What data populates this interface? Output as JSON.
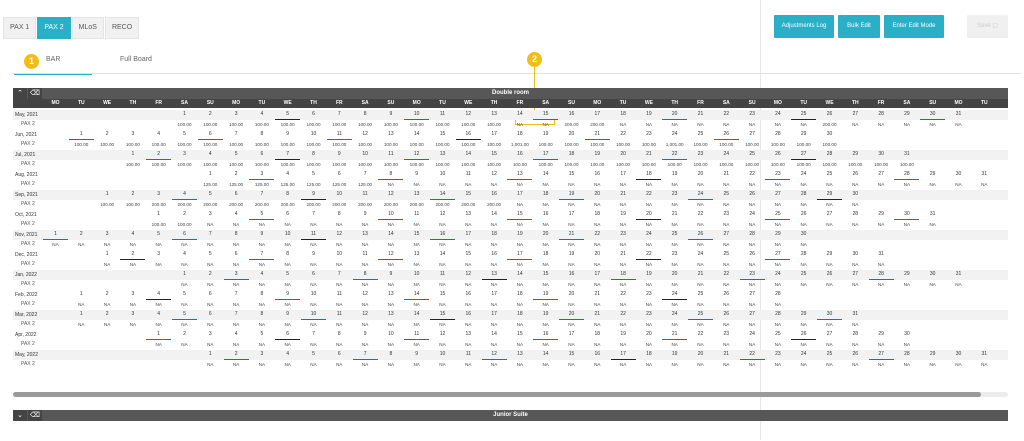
{
  "tabs": [
    {
      "label": "PAX 1",
      "active": false
    },
    {
      "label": "PAX 2",
      "active": true
    },
    {
      "label": "MLoS",
      "active": false
    },
    {
      "label": "RECO",
      "active": false
    }
  ],
  "actions": {
    "adjustments_log": "Adjustments Log",
    "bulk_edit": "Bulk Edit",
    "enter_edit_mode": "Enter Edit Mode",
    "save": "Save"
  },
  "subtabs": {
    "bar": "BAR",
    "full_board": "Full Board"
  },
  "callouts": {
    "one": "1",
    "two": "2"
  },
  "rooms": [
    {
      "title": "Double room"
    },
    {
      "title": "Junior Suite"
    }
  ],
  "weekdays": [
    "MO",
    "TU",
    "WE",
    "TH",
    "FR",
    "SA",
    "SU",
    "MO",
    "TU",
    "WE",
    "TH",
    "FR",
    "SA",
    "SU",
    "MO",
    "TU",
    "WE",
    "TH",
    "FR",
    "SA",
    "SU",
    "MO",
    "TU",
    "WE",
    "TH",
    "FR",
    "SA",
    "SU",
    "MO",
    "TU",
    "WE",
    "TH",
    "FR",
    "SA",
    "SU",
    "MO",
    "TU"
  ],
  "pax_label": "PAX 2",
  "months": [
    {
      "label": "May, 2021",
      "offset": 5,
      "days": 31,
      "vals": [
        "100.00",
        "100.00",
        "100.00",
        "100.00",
        "100.00",
        "100.00",
        "100.00",
        "100.00",
        "100.00",
        "100.00",
        "100.00",
        "100.00",
        "100.00",
        "NA",
        "NA",
        "200.00",
        "200.00",
        "NA",
        "NA",
        "NA",
        "NA",
        "NA",
        "NA",
        "NA",
        "NA",
        "200.00",
        "NA",
        "NA",
        "NA",
        "NA",
        "NA"
      ]
    },
    {
      "label": "Jun, 2021",
      "offset": 1,
      "days": 30,
      "vals": [
        "100.00",
        "100.00",
        "100.00",
        "100.00",
        "100.00",
        "100.00",
        "100.00",
        "100.00",
        "100.00",
        "100.00",
        "100.00",
        "100.00",
        "100.00",
        "100.00",
        "100.00",
        "100.00",
        "100.00",
        "1,001.00",
        "100.00",
        "100.00",
        "100.00",
        "100.00",
        "100.00",
        "1,001.00",
        "100.00",
        "100.00",
        "100.00",
        "100.00",
        "100.00",
        "100.00"
      ]
    },
    {
      "label": "Jul, 2021",
      "offset": 3,
      "days": 31,
      "vals": [
        "100.00",
        "100.00",
        "100.00",
        "100.00",
        "100.00",
        "100.00",
        "100.00",
        "100.00",
        "100.00",
        "100.00",
        "100.00",
        "100.00",
        "100.00",
        "100.00",
        "100.00",
        "100.00",
        "100.00",
        "100.00",
        "100.00",
        "100.00",
        "100.00",
        "100.00",
        "100.00",
        "100.00",
        "100.00",
        "100.00",
        "100.00",
        "100.00",
        "100.00",
        "100.00",
        "100.00"
      ]
    },
    {
      "label": "Aug, 2021",
      "offset": 6,
      "days": 31,
      "vals": [
        "125.00",
        "125.00",
        "125.00",
        "125.00",
        "125.00",
        "125.00",
        "125.00",
        "NA",
        "NA",
        "NA",
        "NA",
        "NA",
        "NA",
        "NA",
        "NA",
        "NA",
        "NA",
        "NA",
        "NA",
        "NA",
        "NA",
        "NA",
        "NA",
        "NA",
        "NA",
        "NA",
        "NA",
        "NA",
        "NA",
        "NA",
        "NA"
      ]
    },
    {
      "label": "Sep, 2021",
      "offset": 2,
      "days": 30,
      "vals": [
        "100.00",
        "100.00",
        "200.00",
        "200.00",
        "200.00",
        "200.00",
        "200.00",
        "200.00",
        "200.00",
        "200.00",
        "200.00",
        "200.00",
        "200.00",
        "200.00",
        "200.00",
        "200.00",
        "NA",
        "NA",
        "NA",
        "NA",
        "NA",
        "NA",
        "NA",
        "NA",
        "NA",
        "NA",
        "NA",
        "NA",
        "NA",
        "NA"
      ]
    },
    {
      "label": "Oct, 2021",
      "offset": 4,
      "days": 31,
      "vals": [
        "100.00",
        "100.00",
        "NA",
        "NA",
        "NA",
        "NA",
        "NA",
        "NA",
        "NA",
        "NA",
        "NA",
        "NA",
        "NA",
        "NA",
        "NA",
        "NA",
        "NA",
        "NA",
        "NA",
        "NA",
        "NA",
        "NA",
        "NA",
        "NA",
        "NA",
        "NA",
        "NA",
        "NA",
        "NA",
        "NA",
        "NA"
      ]
    },
    {
      "label": "Nov, 2021",
      "offset": 0,
      "days": 30,
      "vals": [
        "NA",
        "NA",
        "NA",
        "NA",
        "NA",
        "NA",
        "NA",
        "NA",
        "NA",
        "NA",
        "NA",
        "NA",
        "NA",
        "NA",
        "NA",
        "NA",
        "NA",
        "NA",
        "NA",
        "NA",
        "NA",
        "NA",
        "NA",
        "NA",
        "NA",
        "NA",
        "NA",
        "NA",
        "NA",
        "NA"
      ]
    },
    {
      "label": "Dec, 2021",
      "offset": 2,
      "days": 31,
      "vals": [
        "NA",
        "NA",
        "NA",
        "NA",
        "NA",
        "NA",
        "NA",
        "NA",
        "NA",
        "NA",
        "NA",
        "NA",
        "NA",
        "NA",
        "NA",
        "NA",
        "NA",
        "NA",
        "NA",
        "NA",
        "NA",
        "NA",
        "NA",
        "NA",
        "NA",
        "NA",
        "NA",
        "NA",
        "NA",
        "NA",
        "NA"
      ]
    },
    {
      "label": "Jan, 2022",
      "offset": 5,
      "days": 31,
      "vals": [
        "NA",
        "NA",
        "NA",
        "NA",
        "NA",
        "NA",
        "NA",
        "NA",
        "NA",
        "NA",
        "NA",
        "NA",
        "NA",
        "NA",
        "NA",
        "NA",
        "NA",
        "NA",
        "NA",
        "NA",
        "NA",
        "NA",
        "NA",
        "NA",
        "NA",
        "NA",
        "NA",
        "NA",
        "NA",
        "NA",
        "NA"
      ]
    },
    {
      "label": "Feb, 2022",
      "offset": 1,
      "days": 28,
      "vals": [
        "NA",
        "NA",
        "NA",
        "NA",
        "NA",
        "NA",
        "NA",
        "NA",
        "NA",
        "NA",
        "NA",
        "NA",
        "NA",
        "NA",
        "NA",
        "NA",
        "NA",
        "NA",
        "NA",
        "NA",
        "NA",
        "NA",
        "NA",
        "NA",
        "NA",
        "NA",
        "NA",
        "NA"
      ]
    },
    {
      "label": "Mar, 2022",
      "offset": 1,
      "days": 31,
      "vals": [
        "NA",
        "NA",
        "NA",
        "NA",
        "NA",
        "NA",
        "NA",
        "NA",
        "NA",
        "NA",
        "NA",
        "NA",
        "NA",
        "NA",
        "NA",
        "NA",
        "NA",
        "NA",
        "NA",
        "NA",
        "NA",
        "NA",
        "NA",
        "NA",
        "NA",
        "NA",
        "NA",
        "NA",
        "NA",
        "NA",
        "NA"
      ]
    },
    {
      "label": "Apr, 2022",
      "offset": 4,
      "days": 30,
      "vals": [
        "NA",
        "NA",
        "NA",
        "NA",
        "NA",
        "NA",
        "NA",
        "NA",
        "NA",
        "NA",
        "NA",
        "NA",
        "NA",
        "NA",
        "NA",
        "NA",
        "NA",
        "NA",
        "NA",
        "NA",
        "NA",
        "NA",
        "NA",
        "NA",
        "NA",
        "NA",
        "NA",
        "NA",
        "NA",
        "NA"
      ]
    },
    {
      "label": "May, 2022",
      "offset": 6,
      "days": 31,
      "vals": [
        "NA",
        "NA",
        "NA",
        "NA",
        "NA",
        "NA",
        "NA",
        "NA",
        "NA",
        "NA",
        "NA",
        "NA",
        "NA",
        "NA",
        "NA",
        "NA",
        "NA",
        "NA",
        "NA",
        "NA",
        "NA",
        "NA",
        "NA",
        "NA",
        "NA",
        "NA",
        "NA",
        "NA",
        "NA",
        "NA",
        "NA"
      ]
    }
  ]
}
